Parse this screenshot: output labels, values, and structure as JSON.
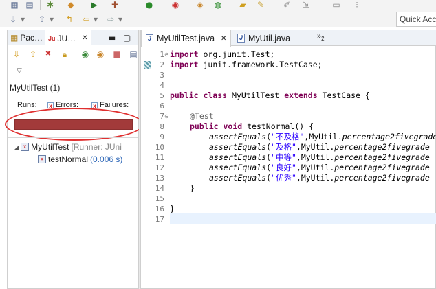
{
  "toolbar": {
    "row1_icons": [
      "team-icon",
      "navigate-icon",
      "debug-icon",
      "run-icon",
      "coverage-icon",
      "new-icon",
      "open-folder-icon",
      "search-icon",
      "search-dropdown-icon",
      "pin-icon",
      "pen-icon",
      "bookmark-icon",
      "lookup-icon",
      "code-icon"
    ],
    "row2_icons": [
      "next-annotation-icon",
      "prev-annotation-icon",
      "last-edit-icon",
      "back-icon",
      "forward-icon"
    ],
    "quick_access_text": "Quick Acc"
  },
  "left_panel": {
    "tabs": [
      {
        "label": "Pac…",
        "icon": "package-explorer-icon"
      },
      {
        "label": "JU…",
        "icon": "junit-icon",
        "close": "✕"
      }
    ],
    "junit_title": "MyUtilTest (1)",
    "counters": {
      "runs_label": "Runs:",
      "errors_label": "Errors:",
      "failures_label": "Failures:"
    },
    "progress": {
      "state": "failed",
      "fraction": 1.0,
      "color": "#a23a3a"
    },
    "tree": [
      {
        "label": "MyUtilTest",
        "suffix": " [Runner: JUni",
        "level": 0
      },
      {
        "label": "testNormal",
        "suffix": " (0.006 s)",
        "level": 1
      }
    ]
  },
  "editor": {
    "tabs": [
      {
        "label": "MyUtilTest.java",
        "close": "✕",
        "active": true
      },
      {
        "label": "MyUtil.java",
        "active": false
      }
    ],
    "overflow": {
      "text": "»",
      "count": "2"
    },
    "line_numbers": [
      "1",
      "2",
      "3",
      "4",
      "5",
      "6",
      "7",
      "8",
      "9",
      "10",
      "11",
      "12",
      "13",
      "14",
      "15",
      "16",
      "17"
    ],
    "code": {
      "l1_kw": "import",
      "l1_rest": " org.junit.Test;",
      "l2_kw": "import",
      "l2_rest": " junit.framework.TestCase;",
      "l5_kw1": "public",
      "l5_kw2": " class",
      "l5_mid": " MyUtilTest ",
      "l5_kw3": "extends",
      "l5_rest": " TestCase {",
      "l7_ann": "@Test",
      "l8_kw1": "public",
      "l8_kw2": " void",
      "l8_rest": " testNormal() {",
      "asserts": [
        {
          "method": "assertEquals",
          "str": "\"不及格\"",
          "rest": ",MyUtil.",
          "call": "percentage2fivegrade"
        },
        {
          "method": "assertEquals",
          "str": "\"及格\"",
          "rest": ",MyUtil.",
          "call": "percentage2fivegrade"
        },
        {
          "method": "assertEquals",
          "str": "\"中等\"",
          "rest": ",MyUtil.",
          "call": "percentage2fivegrade"
        },
        {
          "method": "assertEquals",
          "str": "\"良好\"",
          "rest": ",MyUtil.",
          "call": "percentage2fivegrade"
        },
        {
          "method": "assertEquals",
          "str": "\"优秀\"",
          "rest": ",MyUtil.",
          "call": "percentage2fivegrade"
        }
      ],
      "l14": "}",
      "l16": "}"
    }
  },
  "colors": {
    "keyword": "#7f0055",
    "string": "#2a00ff",
    "annotation": "#646464",
    "failure_bar": "#a23a3a",
    "highlight_circle": "#e03030"
  }
}
